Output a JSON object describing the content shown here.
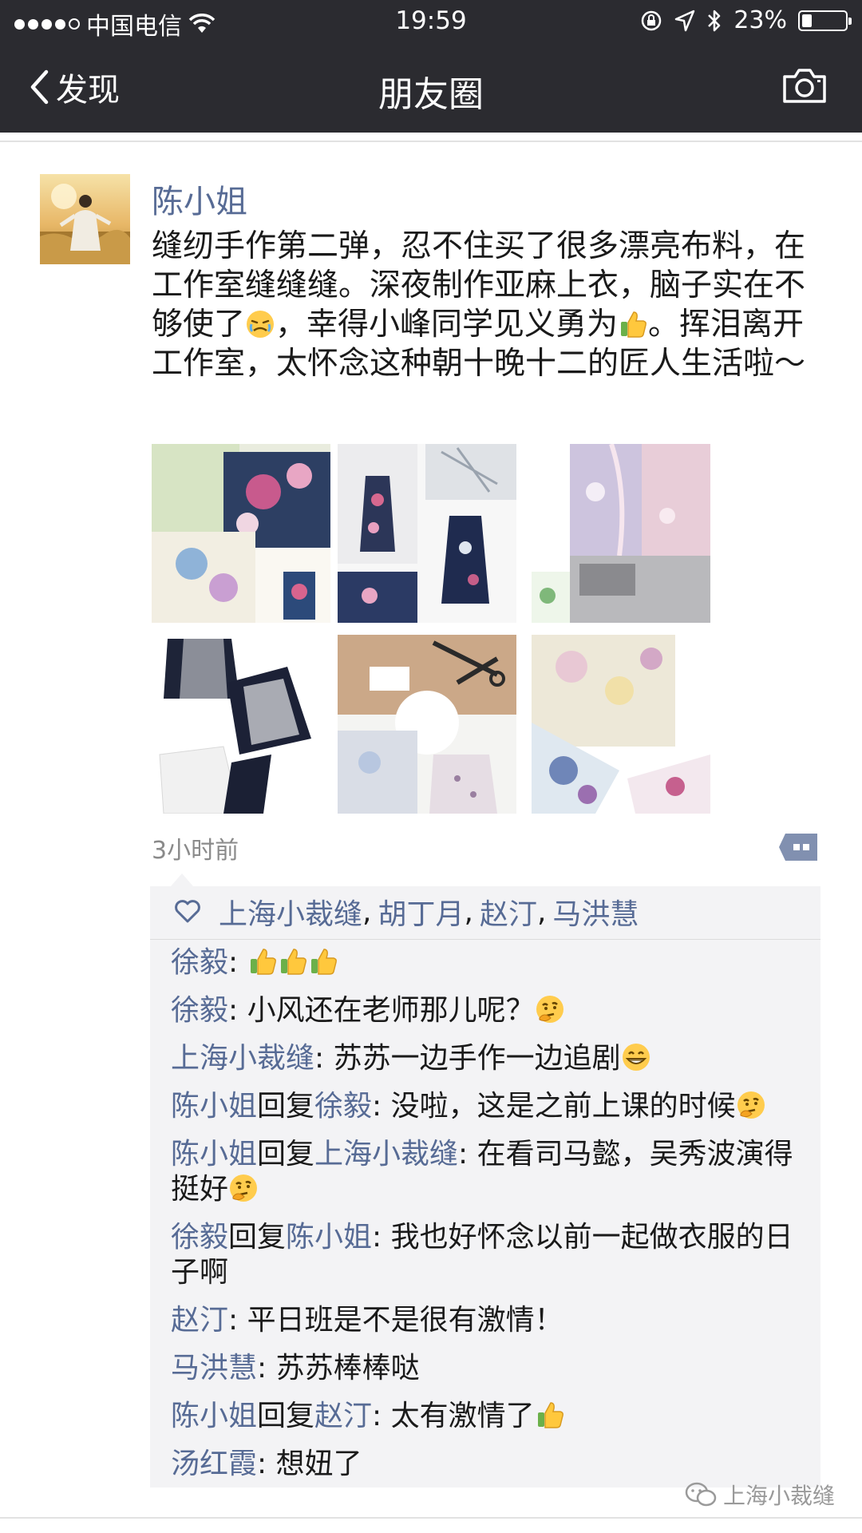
{
  "status_bar": {
    "carrier": "中国电信",
    "time": "19:59",
    "battery_percent": "23%",
    "battery_level": 0.23
  },
  "nav": {
    "back_label": "发现",
    "title": "朋友圈"
  },
  "post": {
    "author": "陈小姐",
    "text_1": "缝纫手作第二弹，忍不住买了很多漂亮布料，在工作室缝缝缝。深夜制作亚麻上衣，脑子实在不够使了",
    "text_2": "，幸得小峰同学见义勇为",
    "text_3": "。挥泪离开工作室，太怀念这种朝十晚十二的匠人生活啦～",
    "time_ago": "3小时前",
    "images": [
      {
        "name": "floral-fabric-pile"
      },
      {
        "name": "floral-dress-on-mannequin"
      },
      {
        "name": "pink-floral-fabric"
      },
      {
        "name": "navy-white-tops"
      },
      {
        "name": "paper-pattern-and-scissors"
      },
      {
        "name": "floral-fabric-swatches"
      }
    ]
  },
  "likes": {
    "names": [
      "上海小裁缝",
      "胡丁月",
      "赵汀",
      "马洪慧"
    ]
  },
  "comments": [
    {
      "from": "徐毅",
      "to": "",
      "text": "",
      "emojis": [
        "thumbs-up",
        "thumbs-up",
        "thumbs-up"
      ]
    },
    {
      "from": "徐毅",
      "to": "",
      "text": "小风还在老师那儿呢？",
      "emojis": [
        "thinking"
      ]
    },
    {
      "from": "上海小裁缝",
      "to": "",
      "text": "苏苏一边手作一边追剧",
      "emojis": [
        "grinning"
      ]
    },
    {
      "from": "陈小姐",
      "to": "徐毅",
      "text": "没啦，这是之前上课的时候",
      "emojis": [
        "thinking"
      ]
    },
    {
      "from": "陈小姐",
      "to": "上海小裁缝",
      "text": "在看司马懿，吴秀波演得挺好",
      "emojis": [
        "thinking"
      ]
    },
    {
      "from": "徐毅",
      "to": "陈小姐",
      "text": "我也好怀念以前一起做衣服的日子啊",
      "emojis": []
    },
    {
      "from": "赵汀",
      "to": "",
      "text": "平日班是不是很有激情！",
      "emojis": []
    },
    {
      "from": "马洪慧",
      "to": "",
      "text": "苏苏棒棒哒",
      "emojis": []
    },
    {
      "from": "陈小姐",
      "to": "赵汀",
      "text": "太有激情了",
      "emojis": [
        "thumbs-up"
      ]
    },
    {
      "from": "汤红霞",
      "to": "",
      "text": "想妞了",
      "emojis": []
    }
  ],
  "labels": {
    "reply_word": "回复",
    "name_colon": ": ",
    "comma": ", "
  },
  "watermark": "上海小裁缝",
  "colors": {
    "bar_bg": "#2b2b30",
    "name_link": "#576b95",
    "comment_bg": "#f3f3f5"
  }
}
